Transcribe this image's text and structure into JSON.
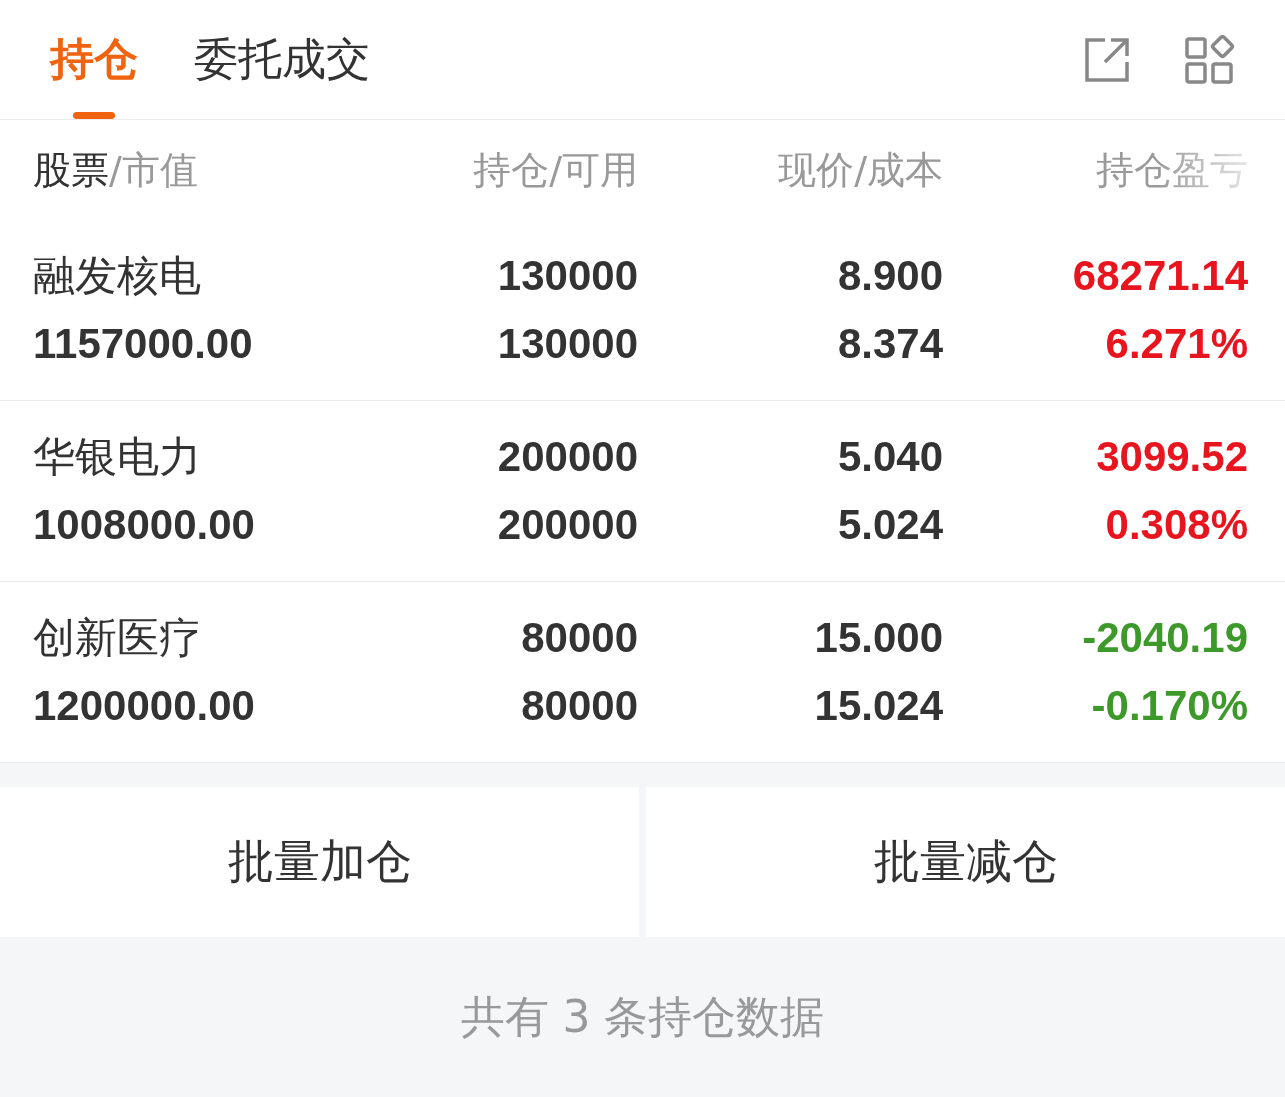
{
  "tabs": [
    {
      "label": "持仓",
      "selected": true
    },
    {
      "label": "委托成交",
      "selected": false
    }
  ],
  "columns": [
    {
      "main": "股票",
      "sub": "/市值"
    },
    {
      "main": "持仓",
      "sub": "/可用"
    },
    {
      "main": "现价",
      "sub": "/成本"
    },
    {
      "main": "持仓盈亏",
      "faded": true
    }
  ],
  "rows": [
    {
      "name": "融发核电",
      "market_value": "1157000.00",
      "holding": "130000",
      "available": "130000",
      "price": "8.900",
      "cost": "8.374",
      "pnl": "68271.14",
      "pnl_pct": "6.271%",
      "color": "#e8141e"
    },
    {
      "name": "华银电力",
      "market_value": "1008000.00",
      "holding": "200000",
      "available": "200000",
      "price": "5.040",
      "cost": "5.024",
      "pnl": "3099.52",
      "pnl_pct": "0.308%",
      "color": "#e8141e"
    },
    {
      "name": "创新医疗",
      "market_value": "1200000.00",
      "holding": "80000",
      "available": "80000",
      "price": "15.000",
      "cost": "15.024",
      "pnl": "-2040.19",
      "pnl_pct": "-0.170%",
      "color": "#3d9a2a"
    }
  ],
  "actions": [
    "批量加仓",
    "批量减仓"
  ],
  "footer": "共有 3 条持仓数据"
}
